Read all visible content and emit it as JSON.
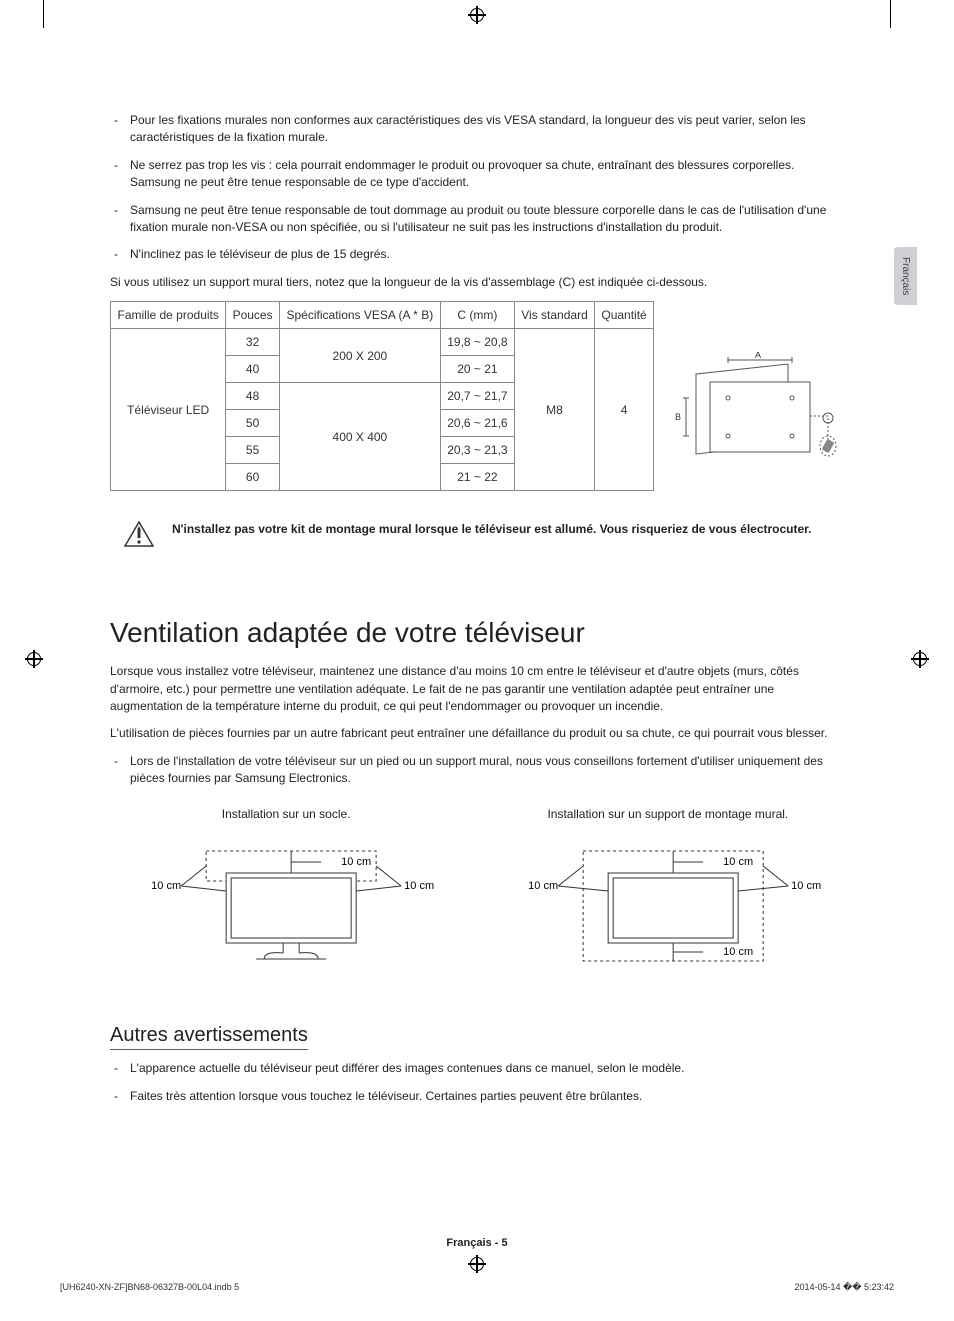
{
  "sideTab": "Français",
  "bullets_top": [
    "Pour les fixations murales non conformes aux caractéristiques des vis VESA standard, la longueur des vis peut varier, selon les caractéristiques de la fixation murale.",
    "Ne serrez pas trop les vis : cela pourrait endommager le produit ou provoquer sa chute, entraînant des blessures corporelles. Samsung ne peut être tenue responsable de ce type d'accident.",
    "Samsung ne peut être tenue responsable de tout dommage au produit ou toute blessure corporelle dans le cas de l'utilisation d'une fixation murale non-VESA ou non spécifiée, ou si l'utilisateur ne suit pas les instructions d'installation du produit.",
    "N'inclinez pas le téléviseur de plus de 15 degrés."
  ],
  "note_line": "Si vous utilisez un support mural tiers, notez que la longueur de la vis d'assemblage (C) est indiquée ci-dessous.",
  "table": {
    "headers": [
      "Famille de produits",
      "Pouces",
      "Spécifications VESA (A * B)",
      "C (mm)",
      "Vis standard",
      "Quantité"
    ],
    "family": "Téléviseur LED",
    "screw": "M8",
    "qty": "4",
    "rows": [
      {
        "inches": "32",
        "vesa": "200 X 200",
        "c": "19,8 ~ 20,8"
      },
      {
        "inches": "40",
        "vesa": "200 X 200",
        "c": "20 ~ 21"
      },
      {
        "inches": "48",
        "vesa": "400 X 400",
        "c": "20,7 ~ 21,7"
      },
      {
        "inches": "50",
        "vesa": "400 X 400",
        "c": "20,6 ~ 21,6"
      },
      {
        "inches": "55",
        "vesa": "400 X 400",
        "c": "20,3 ~ 21,3"
      },
      {
        "inches": "60",
        "vesa": "400 X 400",
        "c": "21 ~ 22"
      }
    ]
  },
  "diagram_labels": {
    "a": "A",
    "b": "B"
  },
  "warning": "N'installez pas votre kit de montage mural lorsque le téléviseur est allumé. Vous risqueriez de vous électrocuter.",
  "h1": "Ventilation adaptée de votre téléviseur",
  "vent_p1": "Lorsque vous installez votre téléviseur, maintenez une distance d'au moins 10 cm entre le téléviseur et d'autre objets (murs, côtés d'armoire, etc.) pour permettre une ventilation adéquate. Le fait de ne pas garantir une ventilation adaptée peut entraîner une augmentation de la température interne du produit, ce qui peut l'endommager ou provoquer un incendie.",
  "vent_p2": "L'utilisation de pièces fournies par un autre fabricant peut entraîner une défaillance du produit ou sa chute, ce qui pourrait vous blesser.",
  "vent_bullet": "Lors de l'installation de votre téléviseur sur un pied ou un support mural, nous vous conseillons fortement d'utiliser uniquement des pièces fournies par Samsung Electronics.",
  "install": {
    "stand_title": "Installation sur un socle.",
    "wall_title": "Installation sur un support de montage mural.",
    "dim_label": "10 cm"
  },
  "h2": "Autres avertissements",
  "other_bullets": [
    "L'apparence actuelle du téléviseur peut différer des images contenues dans ce manuel, selon le modèle.",
    "Faites très attention lorsque vous touchez le téléviseur. Certaines parties peuvent être brûlantes."
  ],
  "footer_page": "Français - 5",
  "footer_left": "[UH6240-XN-ZF]BN68-06327B-00L04.indb   5",
  "footer_right": "2014-05-14   �� 5:23:42"
}
